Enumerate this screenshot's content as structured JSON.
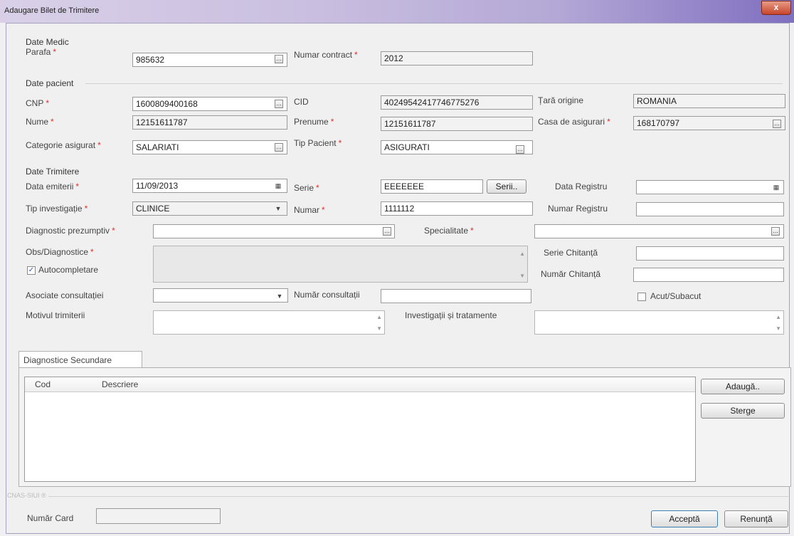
{
  "window": {
    "title": "Adaugare Bilet de Trimitere",
    "close_label": "x"
  },
  "date_medic": {
    "section": "Date Medic",
    "parafa_label": "Parafa",
    "parafa_value": "985632",
    "contract_label": "Numar contract",
    "contract_value": "2012"
  },
  "date_pacient": {
    "section": "Date pacient",
    "cnp_label": "CNP",
    "cnp_value": "1600809400168",
    "cid_label": "CID",
    "cid_value": "40249542417746775276",
    "tara_label": "Țară origine",
    "tara_value": "ROMANIA",
    "nume_label": "Nume",
    "nume_value": "12151611787",
    "prenume_label": "Prenume",
    "prenume_value": "12151611787",
    "casa_label": "Casa de asigurari",
    "casa_value": "168170797",
    "categorie_label": "Categorie asigurat",
    "categorie_value": "SALARIATI",
    "tip_pacient_label": "Tip Pacient",
    "tip_pacient_value": "ASIGURATI"
  },
  "date_trimitere": {
    "section": "Date Trimitere",
    "data_emiterii_label": "Data emiterii",
    "data_emiterii_value": "11/09/2013",
    "serie_label": "Serie",
    "serie_value": "EEEEEEE",
    "serii_button": "Serii..",
    "data_registru_label": "Data Registru",
    "data_registru_value": "",
    "tip_investigatie_label": "Tip investigație",
    "tip_investigatie_value": "CLINICE",
    "numar_label": "Numar",
    "numar_value": "1111112",
    "numar_registru_label": "Numar Registru",
    "numar_registru_value": "",
    "diagnostic_label": "Diagnostic prezumptiv",
    "diagnostic_value": "",
    "specialitate_label": "Specialitate",
    "specialitate_value": "",
    "obs_label": "Obs/Diagnostice",
    "autocompletare_label": "Autocompletare",
    "autocompletare_checked": true,
    "serie_chitanta_label": "Serie Chitanță",
    "numar_chitanta_label": "Număr Chitanță",
    "asociate_label": "Asociate consultației",
    "asociate_value": "",
    "numar_consultatii_label": "Număr consultații",
    "numar_consultatii_value": "",
    "acut_label": "Acut/Subacut",
    "acut_checked": false,
    "motivul_label": "Motivul trimiterii",
    "investigatii_label": "Investigații și tratamente"
  },
  "secundare": {
    "tab_label": "Diagnostice Secundare",
    "columns": [
      "Cod",
      "Descriere"
    ],
    "rows": [],
    "add_button": "Adaugă..",
    "delete_button": "Sterge"
  },
  "footer": {
    "group_label": "CNAS-SIUI ®",
    "numar_card_label": "Număr Card",
    "numar_card_value": "",
    "accept_button": "Acceptă",
    "cancel_button": "Renunță"
  },
  "icons": {
    "ellipsis": "ellipsis-button-icon",
    "calendar": "calendar-icon",
    "dropdown": "chevron-down-icon"
  },
  "colors": {
    "required": "#e0302a",
    "title_gradient_end": "#7f6fc0"
  }
}
